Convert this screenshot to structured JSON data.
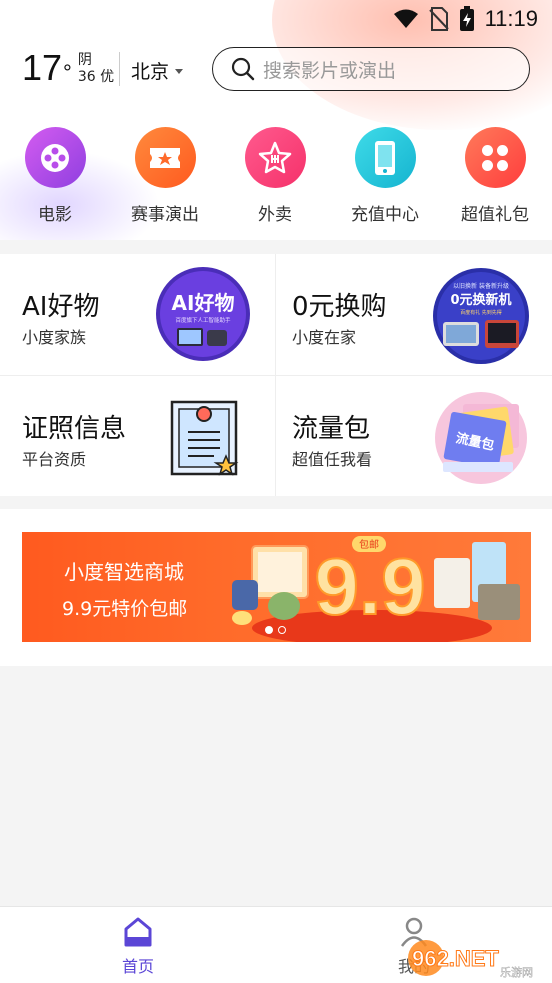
{
  "status_bar": {
    "time": "11:19",
    "icons": [
      "wifi-icon",
      "no-sim-icon",
      "battery-charging-icon"
    ]
  },
  "weather": {
    "temperature": "17",
    "degree": "°",
    "condition": "阴",
    "aqi": "36 优"
  },
  "location": {
    "city": "北京"
  },
  "search": {
    "placeholder": "搜索影片或演出"
  },
  "quick_entries": [
    {
      "label": "电影",
      "icon": "film-reel-icon",
      "color": "#b84dea"
    },
    {
      "label": "赛事演出",
      "icon": "ticket-icon",
      "color": "#ff6a2a"
    },
    {
      "label": "外卖",
      "icon": "food-star-icon",
      "color": "#ff3f7a"
    },
    {
      "label": "充值中心",
      "icon": "phone-icon",
      "color": "#21c7d8"
    },
    {
      "label": "超值礼包",
      "icon": "gift-grid-icon",
      "color": "#ff4d4d"
    }
  ],
  "cards": [
    {
      "title": "AI好物",
      "subtitle": "小度家族",
      "image_text": "AI好物",
      "image_caption": "百度旗下人工智能助手"
    },
    {
      "title": "0元换购",
      "subtitle": "小度在家",
      "image_top": "以旧换新 装备新升级",
      "image_text": "0元换新机",
      "image_caption": "百度有礼 先到先得"
    },
    {
      "title": "证照信息",
      "subtitle": "平台资质",
      "image_icon": "certificate-icon"
    },
    {
      "title": "流量包",
      "subtitle": "超值任我看",
      "image_text": "流量包"
    }
  ],
  "banner": {
    "line1": "小度智选商城",
    "line2": "9.9元特价包邮",
    "price": "9.9",
    "tag": "包邮",
    "slides": 2,
    "active_slide": 1
  },
  "bottom_nav": [
    {
      "label": "首页",
      "icon": "home-icon",
      "active": true
    },
    {
      "label": "我的",
      "icon": "person-icon",
      "active": false
    }
  ],
  "watermark": {
    "text": "962.NET",
    "sub": "乐游网"
  },
  "colors": {
    "accent": "#6b4fd8",
    "banner": "#ff5a1f"
  }
}
